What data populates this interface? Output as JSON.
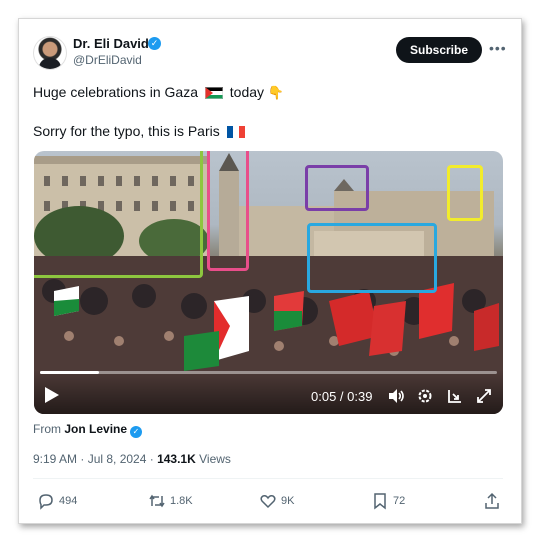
{
  "author": {
    "name": "Dr. Eli David",
    "handle": "@DrEliDavid"
  },
  "header": {
    "subscribe_label": "Subscribe",
    "more_label": "•••"
  },
  "tweet": {
    "line1": "Huge celebrations in Gaza",
    "line1_tail": "today",
    "line2": "Sorry for the typo, this is Paris"
  },
  "video": {
    "time": "0:05 / 0:39",
    "progress": 0.13,
    "annotation_colors": [
      "#8dc63f",
      "#e84e8a",
      "#7a3ea8",
      "#f2ec2c",
      "#29a8e0"
    ]
  },
  "attribution": {
    "prefix": "From",
    "source": "Jon Levine"
  },
  "meta": {
    "time": "9:19 AM · Jul 8, 2024 ·",
    "views_count": "143.1K",
    "views_label": "Views"
  },
  "actions": {
    "replies": "494",
    "reposts": "1.8K",
    "likes": "9K",
    "bookmarks": "72"
  },
  "colors": {
    "accent": "#1d9bf0",
    "text": "#0f1419",
    "muted": "#536471"
  }
}
